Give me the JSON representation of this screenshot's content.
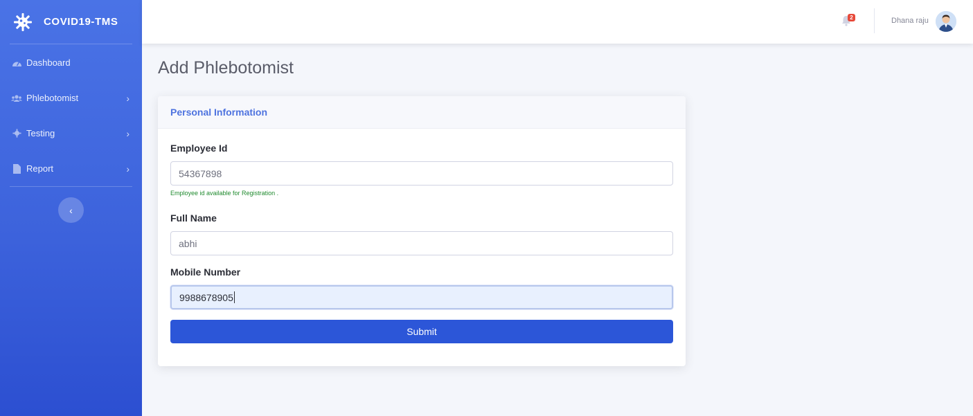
{
  "app": {
    "name": "COVID19-TMS"
  },
  "sidebar": {
    "items": [
      {
        "label": "Dashboard",
        "icon": "dashboard-gauge-icon",
        "has_submenu": false
      },
      {
        "label": "Phlebotomist",
        "icon": "users-icon",
        "has_submenu": true
      },
      {
        "label": "Testing",
        "icon": "virus-icon",
        "has_submenu": true
      },
      {
        "label": "Report",
        "icon": "file-icon",
        "has_submenu": true
      }
    ],
    "toggle_icon": "chevron-left-icon"
  },
  "topbar": {
    "notifications_count": "2",
    "user_name": "Dhana raju"
  },
  "page": {
    "title": "Add Phlebotomist"
  },
  "form": {
    "section_title": "Personal Information",
    "employee_id": {
      "label": "Employee Id",
      "value": "54367898",
      "help": "Employee id available for Registration ."
    },
    "full_name": {
      "label": "Full Name",
      "value": "abhi"
    },
    "mobile_number": {
      "label": "Mobile Number",
      "value": "9988678905"
    },
    "submit_label": "Submit"
  },
  "colors": {
    "sidebar_top": "#4a73e6",
    "sidebar_bottom": "#2c4fd1",
    "primary": "#4e73df",
    "button": "#2c56d8",
    "success_text": "#1f8a2e",
    "badge": "#e74a3b"
  }
}
